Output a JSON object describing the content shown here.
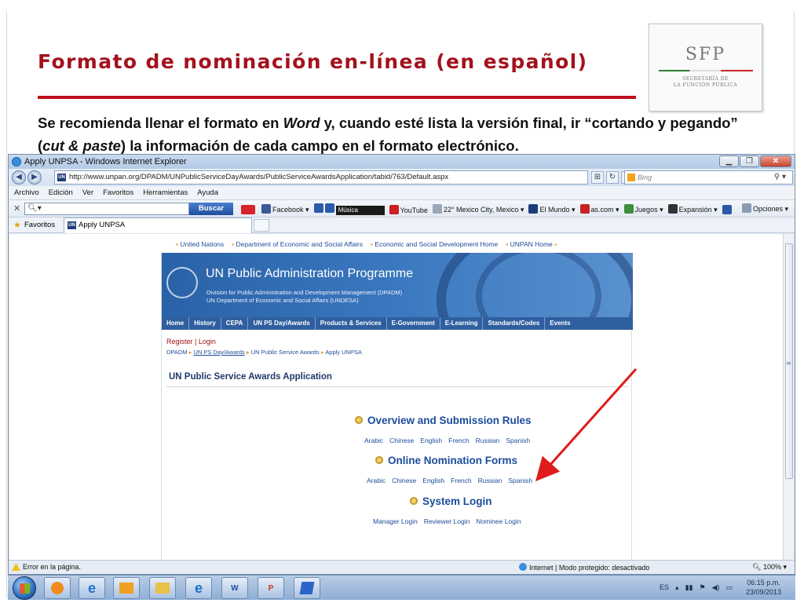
{
  "slide": {
    "title": "Formato de nominación en-línea (en español)",
    "body_part1": "Se recomienda llenar el formato en ",
    "body_word": "Word",
    "body_part2": " y, cuando esté lista la versión final, ir “cortando y pegando” (",
    "body_cutpaste": "cut & paste",
    "body_part3": ") la información de cada campo en el formato electrónico.",
    "logo": {
      "abbr": "SFP",
      "line1": "SECRETARÍA DE",
      "line2": "LA FUNCIÓN PÚBLICA"
    }
  },
  "browser": {
    "window_title": "Apply UNPSA - Windows Internet Explorer",
    "url": "http://www.unpan.org/DPADM/UNPublicServiceDayAwards/PublicServiceAwardsApplication/tabid/763/Default.aspx",
    "search_placeholder": "Bing",
    "menu": [
      "Archivo",
      "Edición",
      "Ver",
      "Favoritos",
      "Herramientas",
      "Ayuda"
    ],
    "toolbar": {
      "search_button": "Buscar",
      "facebook": "Facebook",
      "music": "Música",
      "youtube": "YouTube",
      "weather": "22° Mexico City, Mexico",
      "elmundo": "El Mundo",
      "ascom": "as.com",
      "juegos": "Juegos",
      "expansion": "Expansión",
      "opciones": "Opciones"
    },
    "favorites_label": "Favoritos",
    "tab_label": "Apply UNPSA",
    "status": {
      "error": "Error en la página.",
      "zone": "Internet | Modo protegido: desactivado",
      "zoom": "100%"
    }
  },
  "page": {
    "topnav": [
      "United Nations",
      "Department of Economic and Social Affairs",
      "Economic and Social Development Home",
      "UNPAN Home"
    ],
    "banner_title": "UN Public Administration Programme",
    "banner_sub1": "Division for Public Administration and Development Management (DPADM)",
    "banner_sub2": "UN Department of Economic and Social Affairs (UNDESA)",
    "menu": [
      "Home",
      "History",
      "CEPA",
      "UN PS Day/Awards",
      "Products & Services",
      "E-Government",
      "E-Learning",
      "Standards/Codes",
      "Events"
    ],
    "register": "Register",
    "login": "Login",
    "breadcrumbs": [
      "DPADM",
      "UN PS Day/Awards",
      "UN Public Service Awards",
      "Apply UNPSA"
    ],
    "heading": "UN Public Service Awards Application",
    "sections": [
      {
        "title": "Overview and Submission Rules",
        "links": [
          "Arabic",
          "Chinese",
          "English",
          "French",
          "Russian",
          "Spanish"
        ]
      },
      {
        "title": "Online Nomination Forms",
        "links": [
          "Arabic",
          "Chinese",
          "English",
          "French",
          "Russian",
          "Spanish"
        ]
      },
      {
        "title": "System Login",
        "links": [
          "Manager Login",
          "Reviewer Login",
          "Nominee Login"
        ]
      }
    ]
  },
  "taskbar": {
    "lang": "ES",
    "time": "06:15 p.m.",
    "date": "23/09/2013",
    "word_icon": "W",
    "ppt_icon": "P"
  },
  "colors": {
    "title": "#a3111d",
    "rule": "#c0101e",
    "arrow": "#e01b1b",
    "link": "#1c4b9a"
  }
}
